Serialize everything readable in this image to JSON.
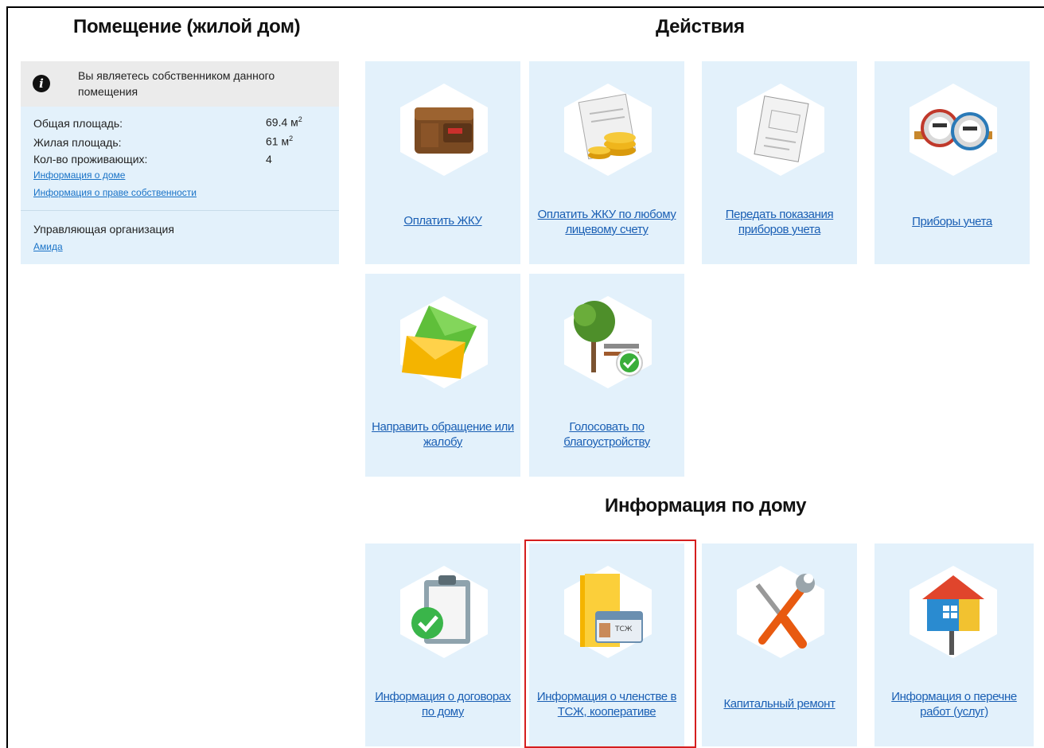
{
  "room": {
    "heading": "Помещение (жилой дом)",
    "owner_notice": "Вы являетесь собственником данного помещения",
    "params": [
      {
        "label": "Общая площадь:",
        "value": "69.4 м",
        "sup": "2"
      },
      {
        "label": "Жилая площадь:",
        "value": "61 м",
        "sup": "2"
      },
      {
        "label": "Кол-во проживающих:",
        "value": "4",
        "sup": ""
      }
    ],
    "links": {
      "house_info": "Информация о доме",
      "ownership_info": "Информация о праве собственности"
    },
    "management": {
      "label": "Управляющая организация",
      "company": "Амида"
    }
  },
  "actions": {
    "heading": "Действия",
    "tiles": [
      {
        "label": "Оплатить ЖКУ",
        "icon": "wallet-icon"
      },
      {
        "label": "Оплатить ЖКУ по любому лицевому счету",
        "icon": "coins-bill-icon"
      },
      {
        "label": "Передать показания приборов учета",
        "icon": "readings-form-icon"
      },
      {
        "label": "Приборы учета",
        "icon": "water-meters-icon"
      },
      {
        "label": "Направить обращение или жалобу",
        "icon": "envelopes-icon"
      },
      {
        "label": "Голосовать по благоустройству",
        "icon": "tree-bench-check-icon"
      }
    ]
  },
  "house_info": {
    "heading": "Информация по дому",
    "tiles": [
      {
        "label": "Информация о договорах по дому",
        "icon": "clipboard-check-icon"
      },
      {
        "label": "Информация о членстве в ТСЖ, кооперативе",
        "icon": "folder-badge-icon",
        "badge_text": "ТСЖ"
      },
      {
        "label": "Капитальный ремонт",
        "icon": "wrench-screwdriver-icon"
      },
      {
        "label": "Информация о перечне работ (услуг)",
        "icon": "house-paint-roller-icon"
      }
    ]
  },
  "colors": {
    "tile_bg": "#e3f1fb",
    "link": "#1a5fb4",
    "highlight": "#d51e1e"
  }
}
